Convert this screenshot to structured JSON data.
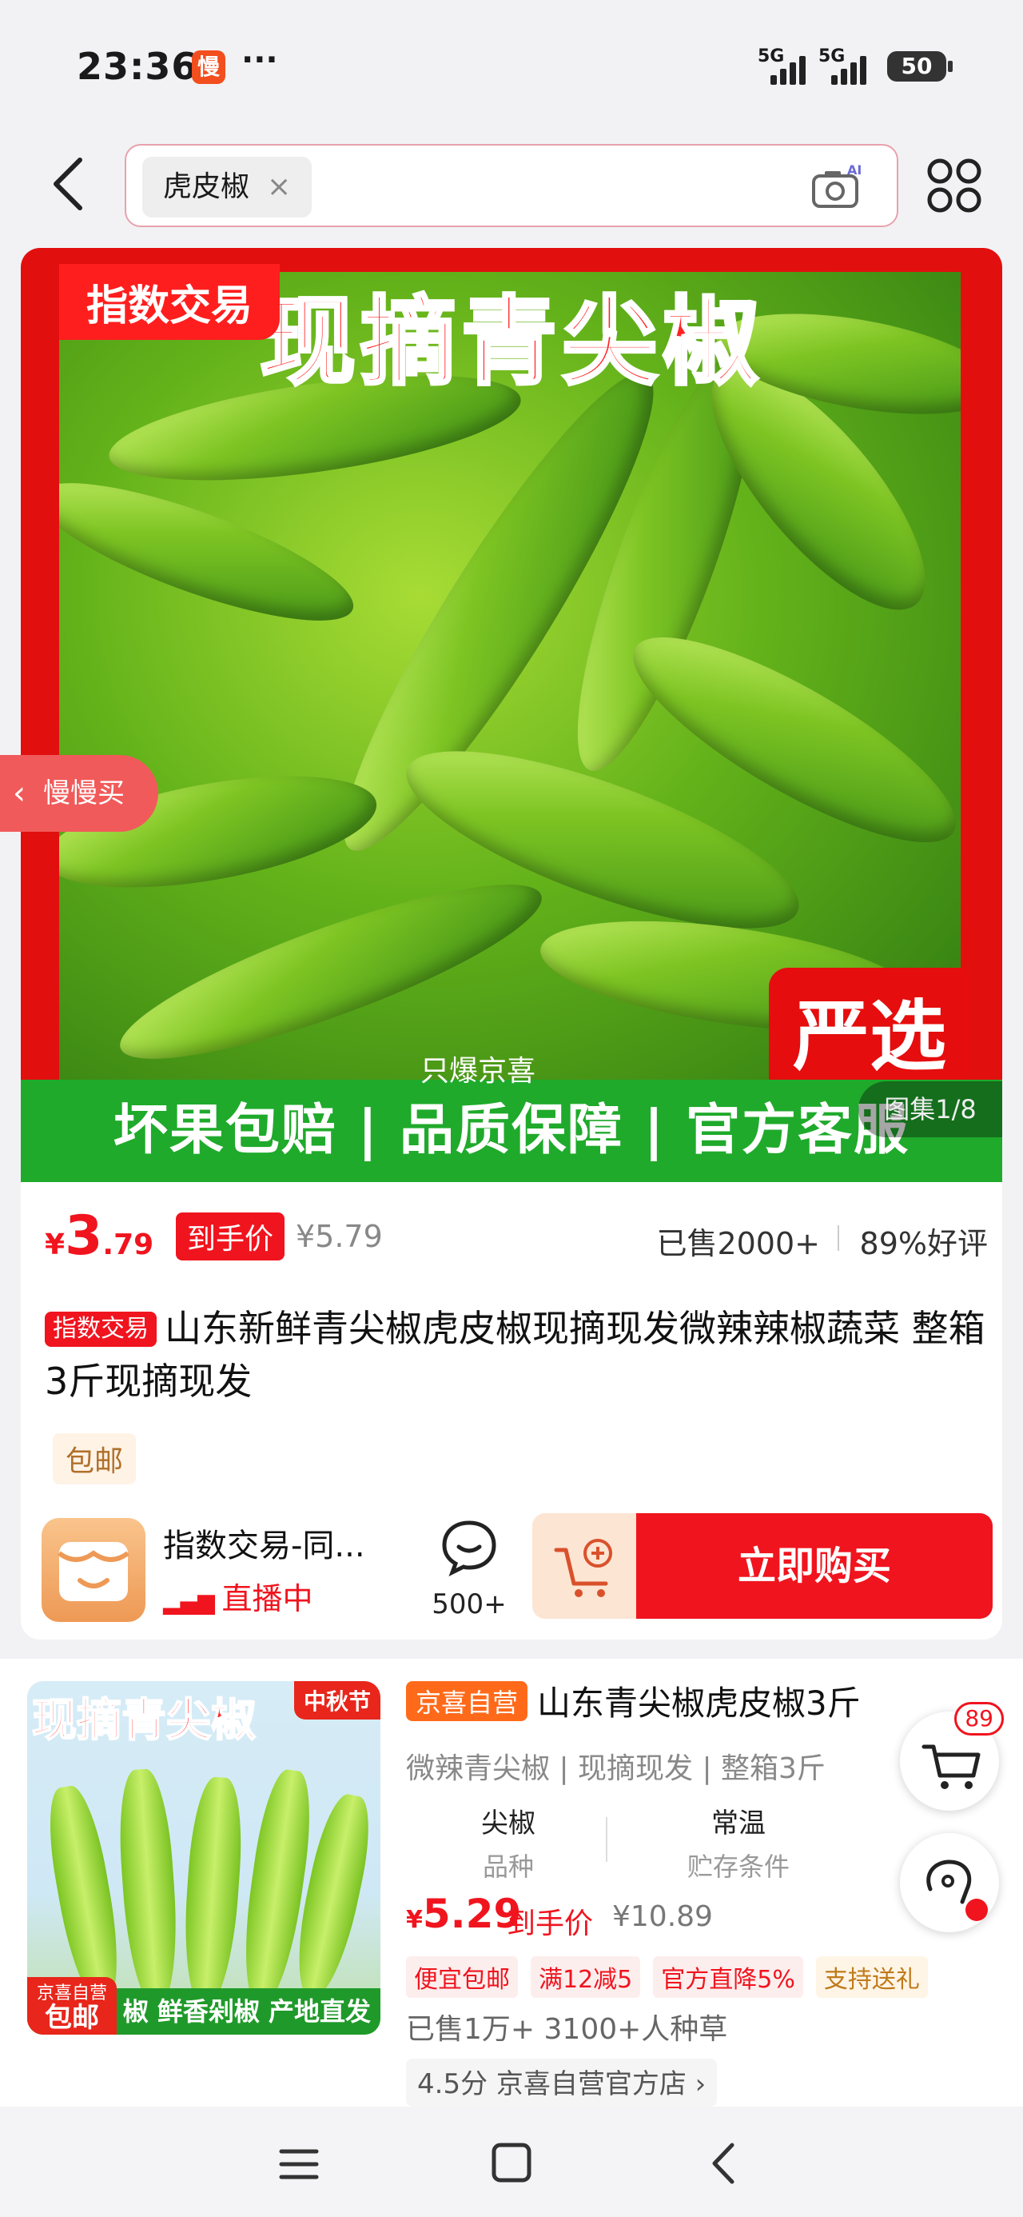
{
  "status_bar": {
    "time": "23:36",
    "app_badge": "慢",
    "more": "···",
    "net1": "5G",
    "net2": "5G",
    "battery": "50"
  },
  "header": {
    "search_tag": "虎皮椒",
    "tag_close": "×",
    "camera_ai": "AI"
  },
  "hero": {
    "badge": "指数交易",
    "title": "现摘青尖椒",
    "select": "严选",
    "bottom_banner": "坏果包赔 | 品质保障 | 官方客服",
    "watermark": "只爆京喜",
    "gallery": "图集1/8"
  },
  "product": {
    "price_symbol": "¥",
    "price_int": "3",
    "price_dec": ".79",
    "price_tag": "到手价",
    "price_old": "¥5.79",
    "sold": "已售2000+",
    "rating": "89%好评",
    "title_tag": "指数交易",
    "title": "山东新鲜青尖椒虎皮椒现摘现发微辣辣椒蔬菜 整箱3斤现摘现发",
    "shipping": "包邮"
  },
  "store": {
    "name": "指数交易-同...",
    "live": "直播中",
    "chat_count": "500+",
    "buy_label": "立即购买"
  },
  "floating": {
    "slow_buy": "慢慢买",
    "cart_count": "89"
  },
  "product2": {
    "img_title": "现摘青尖椒",
    "img_festival": "中秋节",
    "img_self_top": "京喜自营",
    "img_self_bottom": "包邮",
    "img_strip": "椒 鲜香剁椒 产地直发",
    "badge": "京喜自营",
    "title": "山东青尖椒虎皮椒3斤",
    "subtitle": "微辣青尖椒 | 现摘现发 | 整箱3斤",
    "attr1_value": "尖椒",
    "attr1_key": "品种",
    "attr2_value": "常温",
    "attr2_key": "贮存条件",
    "price_symbol": "¥",
    "price": "5.29",
    "price_label": "到手价",
    "price_old": "¥10.89",
    "promos": [
      "便宜包邮",
      "满12减5",
      "官方直降5%",
      "支持送礼"
    ],
    "sales": "已售1万+  3100+人种草",
    "store": "4.5分  京喜自营官方店 ›"
  }
}
